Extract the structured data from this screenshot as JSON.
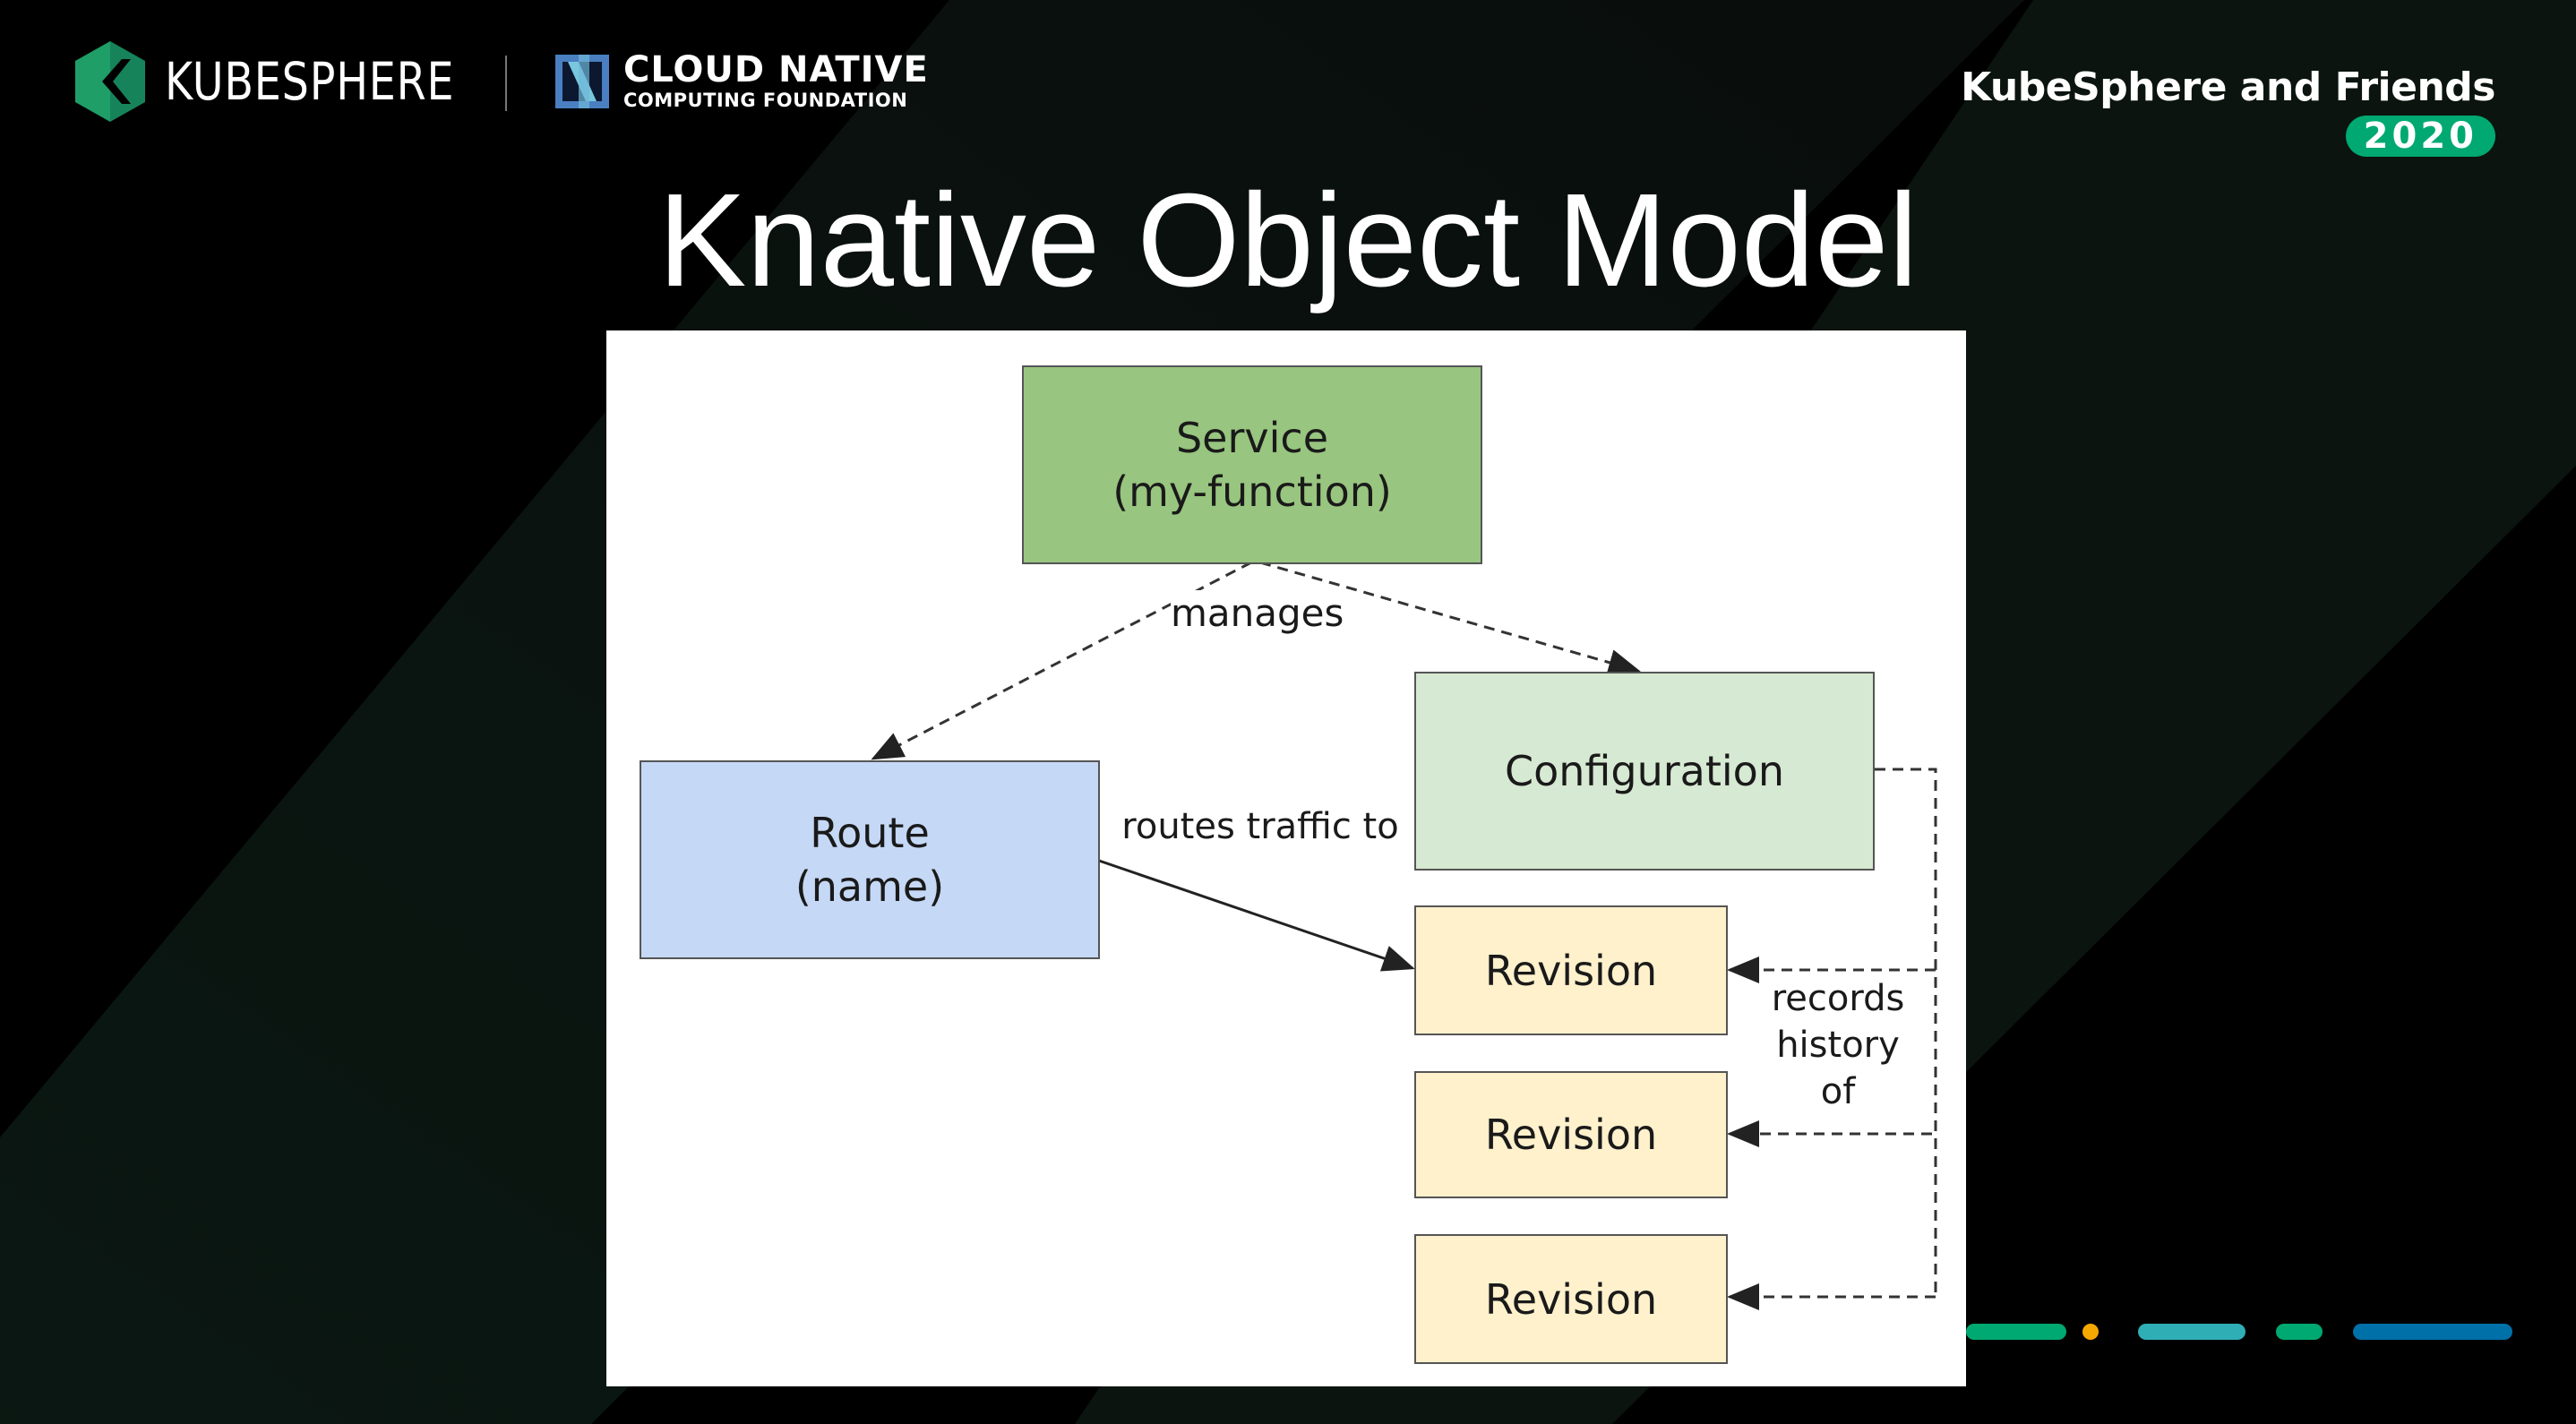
{
  "header": {
    "kubesphere_logo_text": "KUBESPHERE",
    "cncf_line1": "CLOUD NATIVE",
    "cncf_line2": "COMPUTING FOUNDATION",
    "event_title": "KubeSphere and Friends",
    "event_year": "2020"
  },
  "slide": {
    "title": "Knative Object Model"
  },
  "diagram": {
    "nodes": {
      "service": {
        "line1": "Service",
        "line2": "(my-function)",
        "fill": "#98c57f"
      },
      "route": {
        "line1": "Route",
        "line2": "(name)",
        "fill": "#c5d8f5"
      },
      "configuration": {
        "line1": "Configuration",
        "fill": "#d6e9d2"
      },
      "revisions": [
        {
          "label": "Revision",
          "fill": "#fff1cc"
        },
        {
          "label": "Revision",
          "fill": "#fff1cc"
        },
        {
          "label": "Revision",
          "fill": "#fff1cc"
        }
      ]
    },
    "edge_labels": {
      "manages": "manages",
      "routes_traffic_to": "routes traffic to",
      "records_line1": "records",
      "records_line2": "history",
      "records_line3": "of"
    }
  },
  "colors": {
    "brand_green": "#00a971",
    "accent_orange": "#f5a800",
    "accent_teal": "#30aeb5",
    "accent_blue": "#0070a8"
  }
}
